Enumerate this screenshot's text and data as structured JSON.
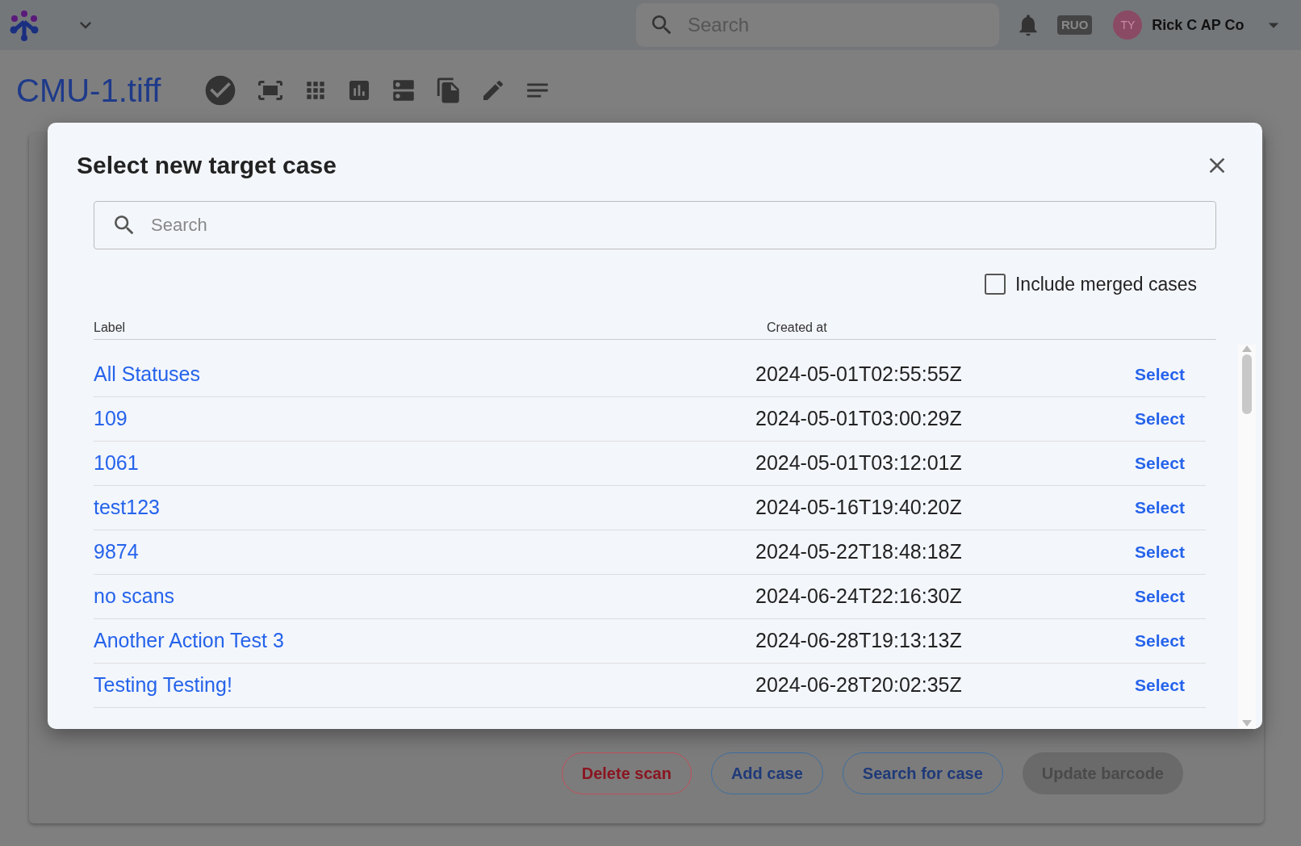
{
  "header": {
    "search": {
      "placeholder": "Search"
    },
    "badge": "RUO",
    "avatar": "TY",
    "user": "Rick C AP Co"
  },
  "page": {
    "title": "CMU-1.tiff",
    "buttons": [
      {
        "label": "Delete scan",
        "kind": "danger"
      },
      {
        "label": "Add case",
        "kind": "outline"
      },
      {
        "label": "Search for case",
        "kind": "outline"
      },
      {
        "label": "Update barcode",
        "kind": "filled"
      }
    ]
  },
  "dialog": {
    "title": "Select new target case",
    "search": {
      "placeholder": "Search"
    },
    "include_merged": {
      "label": "Include merged cases",
      "checked": false
    },
    "columns": [
      "Label",
      "Created at"
    ],
    "rows": [
      {
        "label": "All Statuses",
        "created_at": "2024-05-01T02:55:55Z",
        "action": "Select"
      },
      {
        "label": "109",
        "created_at": "2024-05-01T03:00:29Z",
        "action": "Select"
      },
      {
        "label": "1061",
        "created_at": "2024-05-01T03:12:01Z",
        "action": "Select"
      },
      {
        "label": "test123",
        "created_at": "2024-05-16T19:40:20Z",
        "action": "Select"
      },
      {
        "label": "9874",
        "created_at": "2024-05-22T18:48:18Z",
        "action": "Select"
      },
      {
        "label": "no scans",
        "created_at": "2024-06-24T22:16:30Z",
        "action": "Select"
      },
      {
        "label": "Another Action Test 3",
        "created_at": "2024-06-28T19:13:13Z",
        "action": "Select"
      },
      {
        "label": "Testing Testing!",
        "created_at": "2024-06-28T20:02:35Z",
        "action": "Select"
      }
    ]
  }
}
